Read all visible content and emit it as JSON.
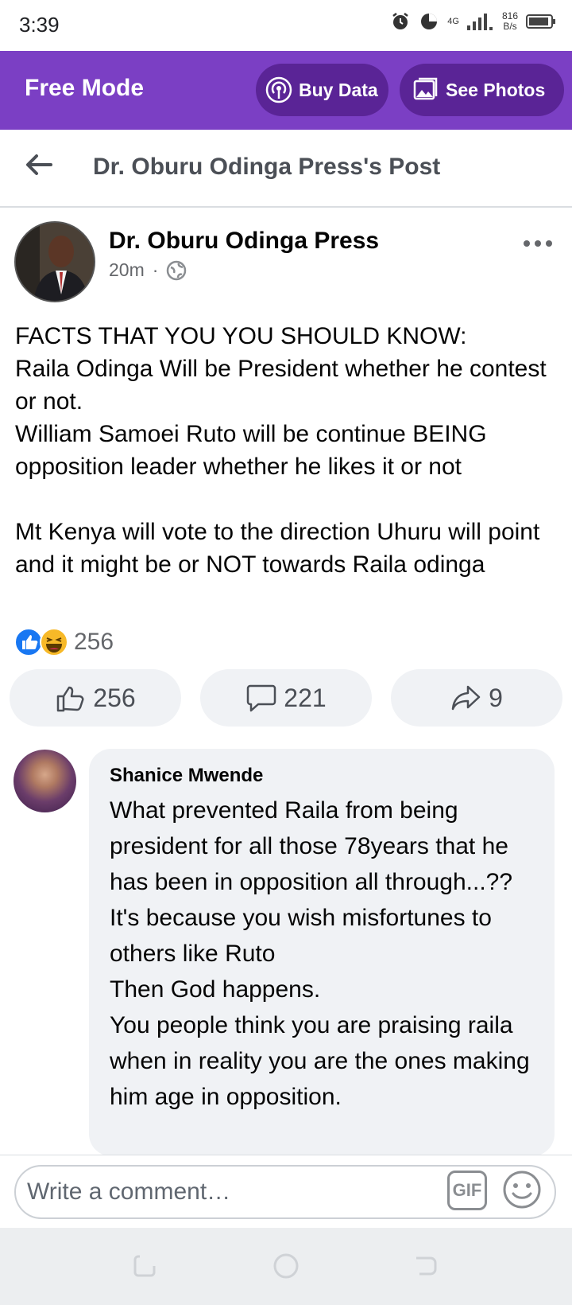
{
  "status_bar": {
    "time": "3:39",
    "network": "4G",
    "speed_value": "816",
    "speed_unit": "B/s"
  },
  "promo_bar": {
    "title": "Free Mode",
    "buy_data_label": "Buy Data",
    "see_photos_label": "See Photos",
    "background_color": "#7b3fc4",
    "button_color": "#5a2496"
  },
  "page_header": {
    "title": "Dr. Oburu Odinga Press's Post"
  },
  "post": {
    "author": "Dr. Oburu Odinga Press",
    "time": "20m",
    "separator": "·",
    "audience_icon": "globe-icon",
    "text": "FACTS THAT YOU YOU SHOULD KNOW:\nRaila Odinga Will be President whether he contest or not.\nWilliam Samoei Ruto will be continue BEING opposition leader whether he likes it or not\n\nMt Kenya will vote to the direction Uhuru will point and it might be or NOT towards Raila odinga",
    "reaction_icons": [
      "like-reaction-icon",
      "haha-reaction-icon"
    ],
    "reaction_count": "256"
  },
  "actions": {
    "like_count": "256",
    "comment_count": "221",
    "share_count": "9"
  },
  "comment": {
    "author": "Shanice Mwende",
    "text": "What prevented Raila from being president for all those 78years that he has been in opposition all through...??\nIt's because you wish misfortunes to others like Ruto\nThen God happens.\nYou people think you are praising raila when in reality you are the ones making him age in opposition."
  },
  "composer": {
    "placeholder": "Write a comment…",
    "gif_label": "GIF"
  }
}
